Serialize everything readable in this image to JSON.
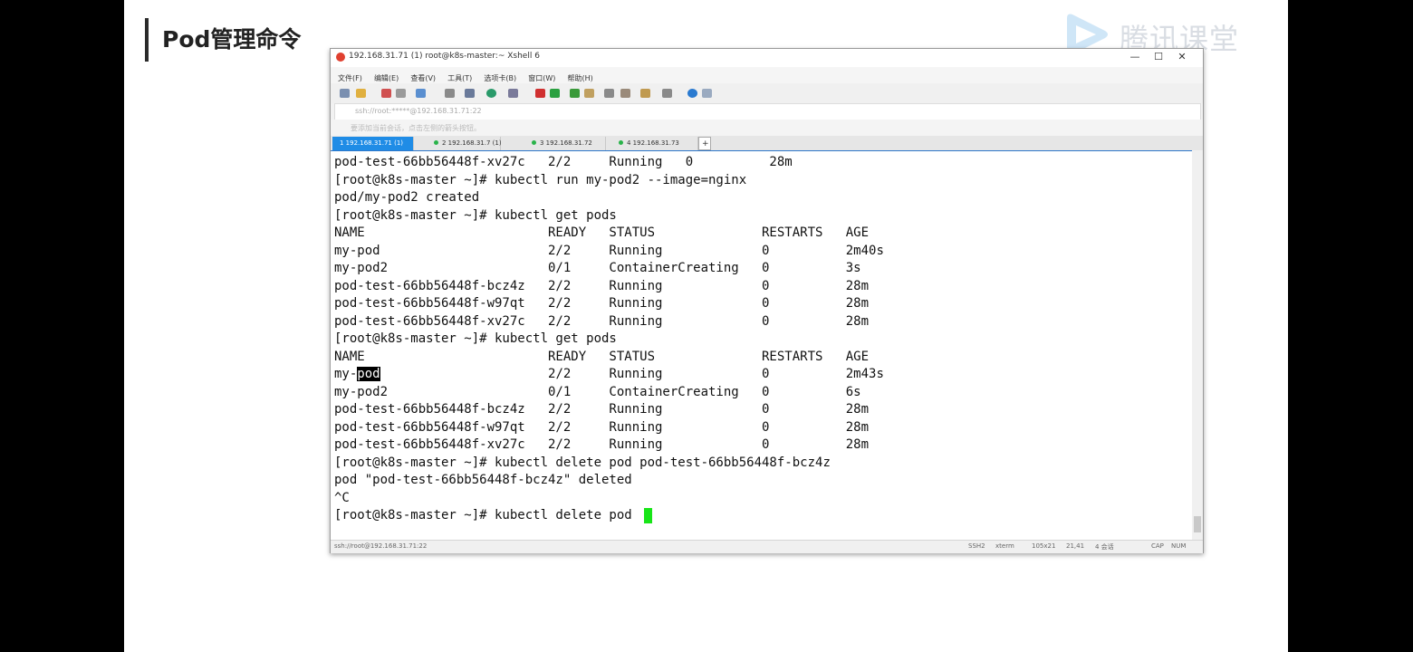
{
  "slide": {
    "title": "Pod管理命令",
    "logo_text": "腾讯课堂"
  },
  "window": {
    "title": "192.168.31.71 (1)   root@k8s-master:~   Xshell 6",
    "controls": [
      "—",
      "☐",
      "✕"
    ],
    "menu": [
      "文件(F)",
      "编辑(E)",
      "查看(V)",
      "工具(T)",
      "选项卡(B)",
      "窗口(W)",
      "帮助(H)"
    ],
    "address": "ssh://root:*****@192.168.31.71:22",
    "hint": "要添加当前会话，点击左侧的箭头按钮。",
    "tabs": [
      {
        "label": "1 192.168.31.71 (1)",
        "active": true
      },
      {
        "label": "2 192.168.31.7  (1)",
        "active": false
      },
      {
        "label": "3 192.168.31.72",
        "active": false
      },
      {
        "label": "4 192.168.31.73",
        "active": false
      }
    ],
    "add_tab": "+"
  },
  "terminal": {
    "lines": [
      "pod-test-66bb56448f-xv27c   2/2     Running   0          28m",
      "[root@k8s-master ~]# kubectl run my-pod2 --image=nginx",
      "pod/my-pod2 created",
      "[root@k8s-master ~]# kubectl get pods",
      "NAME                        READY   STATUS              RESTARTS   AGE",
      "my-pod                      2/2     Running             0          2m40s",
      "my-pod2                     0/1     ContainerCreating   0          3s",
      "pod-test-66bb56448f-bcz4z   2/2     Running             0          28m",
      "pod-test-66bb56448f-w97qt   2/2     Running             0          28m",
      "pod-test-66bb56448f-xv27c   2/2     Running             0          28m",
      "[root@k8s-master ~]# kubectl get pods",
      "NAME                        READY   STATUS              RESTARTS   AGE",
      "my-pod                      2/2     Running             0          2m43s",
      "my-pod2                     0/1     ContainerCreating   0          6s",
      "pod-test-66bb56448f-bcz4z   2/2     Running             0          28m",
      "pod-test-66bb56448f-w97qt   2/2     Running             0          28m",
      "pod-test-66bb56448f-xv27c   2/2     Running             0          28m",
      "[root@k8s-master ~]# kubectl delete pod pod-test-66bb56448f-bcz4z",
      "pod \"pod-test-66bb56448f-bcz4z\" deleted",
      "^C",
      "[root@k8s-master ~]# kubectl delete pod "
    ],
    "selection": {
      "line": 12,
      "prefix": "my-",
      "text": "pod",
      "suffix": "                      2/2     Running             0          2m43s"
    }
  },
  "status": {
    "left": "ssh://root@192.168.31.71:22",
    "items": [
      "SSH2",
      "xterm",
      "105x21",
      "21,41",
      "4 会话",
      "CAP",
      "NUM"
    ]
  }
}
